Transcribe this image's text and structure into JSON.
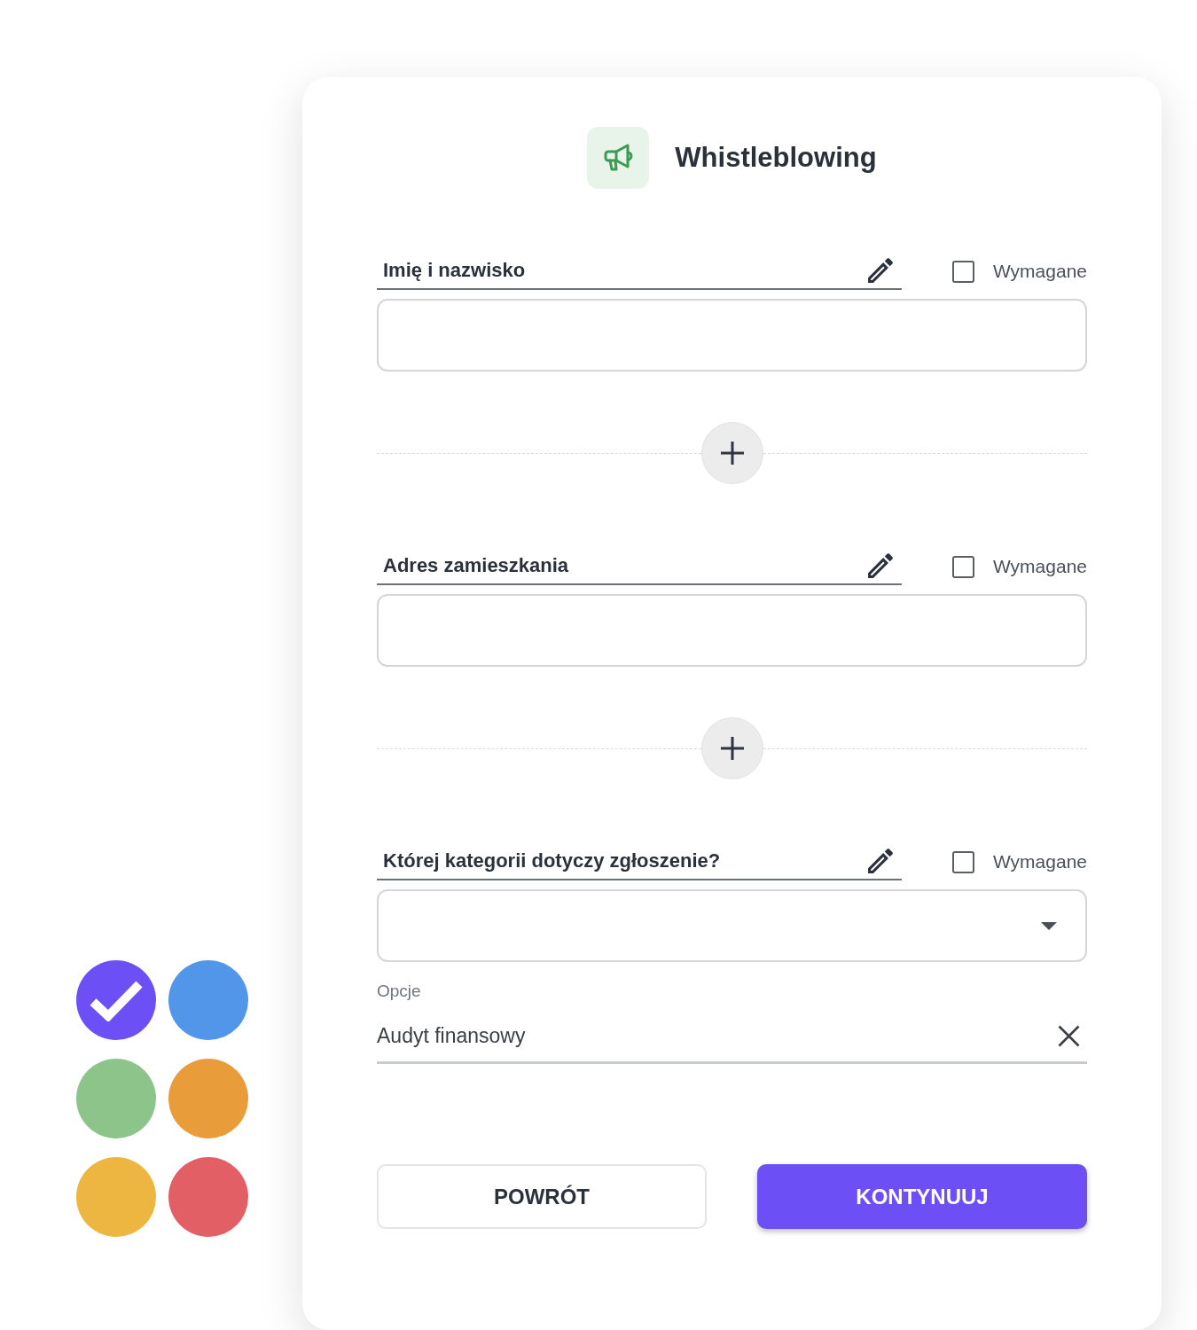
{
  "header": {
    "title": "Whistleblowing"
  },
  "items": [
    {
      "kind": "text",
      "label": "Imię i nazwisko",
      "required": false,
      "required_label": "Wymagane"
    },
    {
      "kind": "add"
    },
    {
      "kind": "text",
      "label": "Adres zamieszkania",
      "required": false,
      "required_label": "Wymagane"
    },
    {
      "kind": "add"
    },
    {
      "kind": "select",
      "label": "Której kategorii dotyczy zgłoszenie?",
      "required": false,
      "required_label": "Wymagane",
      "options_label": "Opcje",
      "options": [
        {
          "text": "Audyt finansowy"
        }
      ]
    }
  ],
  "buttons": [
    {
      "kind": "secondary",
      "label": "POWRÓT"
    },
    {
      "kind": "primary",
      "label": "KONTYNUUJ"
    }
  ],
  "colors": [
    {
      "color": "#6d50f5",
      "selected": true
    },
    {
      "color": "#5296ea",
      "selected": false
    },
    {
      "color": "#8dc489",
      "selected": false
    },
    {
      "color": "#e99c3a",
      "selected": false
    },
    {
      "color": "#edb640",
      "selected": false
    },
    {
      "color": "#e35f66",
      "selected": false
    }
  ]
}
